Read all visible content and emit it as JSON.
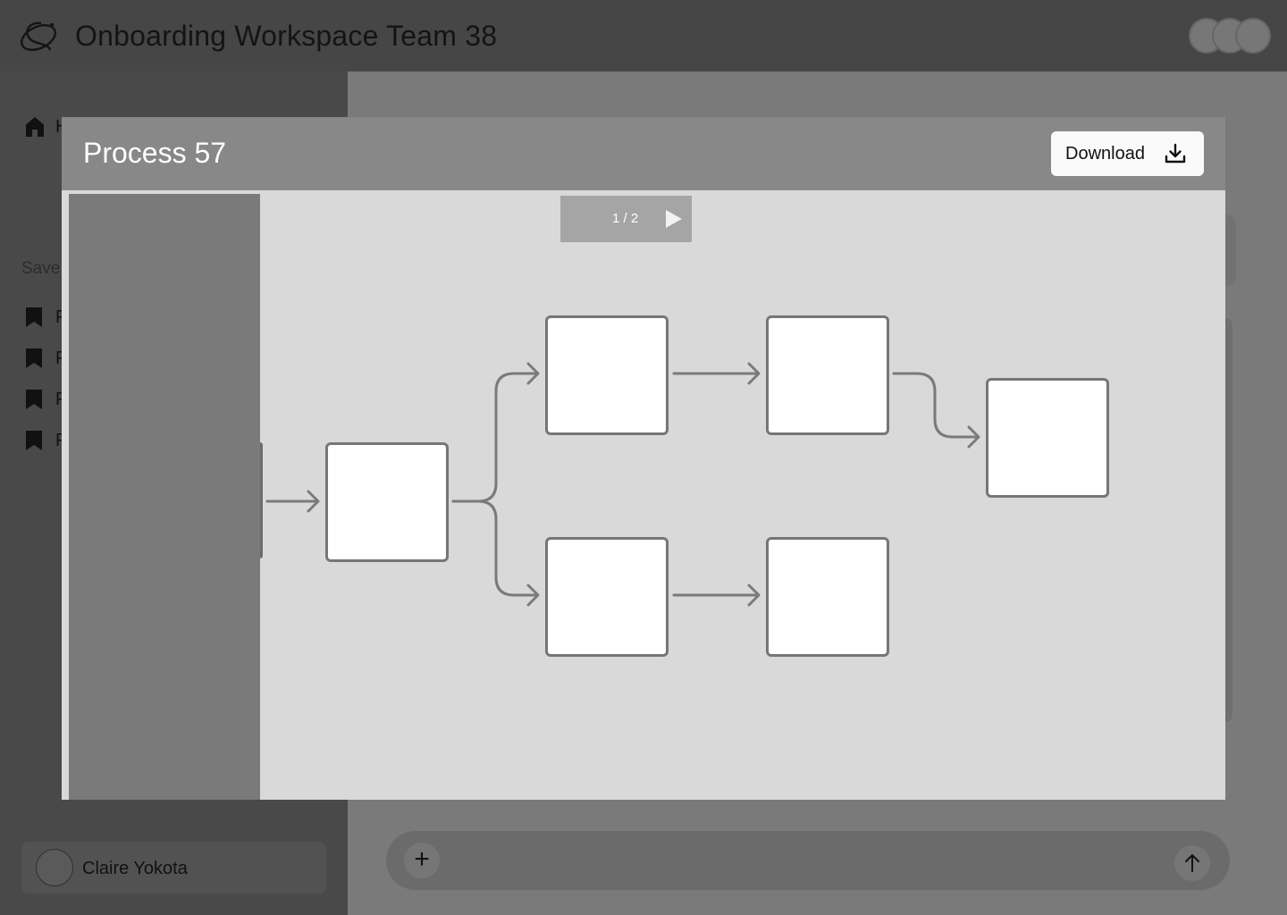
{
  "header": {
    "title": "Onboarding Workspace Team 38"
  },
  "sidebar": {
    "home_label": "H",
    "saved_heading": "Save",
    "saved_items": [
      {
        "label": "P"
      },
      {
        "label": "P"
      },
      {
        "label": "P"
      },
      {
        "label": "P"
      }
    ],
    "user": {
      "name": "Claire Yokota"
    }
  },
  "composer": {
    "add_label": "+"
  },
  "modal": {
    "title": "Process 57",
    "download_label": "Download",
    "pager": {
      "current": 1,
      "total": 2,
      "text": "1 / 2"
    }
  },
  "diagram": {
    "nodes": [
      {
        "id": "n1",
        "label": ""
      },
      {
        "id": "n2",
        "label": ""
      },
      {
        "id": "n3",
        "label": ""
      },
      {
        "id": "n4",
        "label": ""
      },
      {
        "id": "n5",
        "label": ""
      },
      {
        "id": "n6",
        "label": ""
      }
    ],
    "edges": [
      {
        "from": "start",
        "to": "n1"
      },
      {
        "from": "n1",
        "to": "n2"
      },
      {
        "from": "n1",
        "to": "n5"
      },
      {
        "from": "n2",
        "to": "n3"
      },
      {
        "from": "n3",
        "to": "n4"
      },
      {
        "from": "n5",
        "to": "n6"
      }
    ]
  },
  "colors": {
    "overlay_dark": "#464646",
    "modal_header": "#888888",
    "canvas": "#d9d9d9",
    "node_border": "#767676",
    "arrow": "#7a7a7a"
  },
  "icons": {
    "logo": "orbit-logo-icon",
    "home": "home-icon",
    "saved": "bookmark-icon",
    "download": "download-icon",
    "pager_next": "play-next-icon",
    "send": "arrow-up-icon",
    "add": "plus-icon"
  }
}
